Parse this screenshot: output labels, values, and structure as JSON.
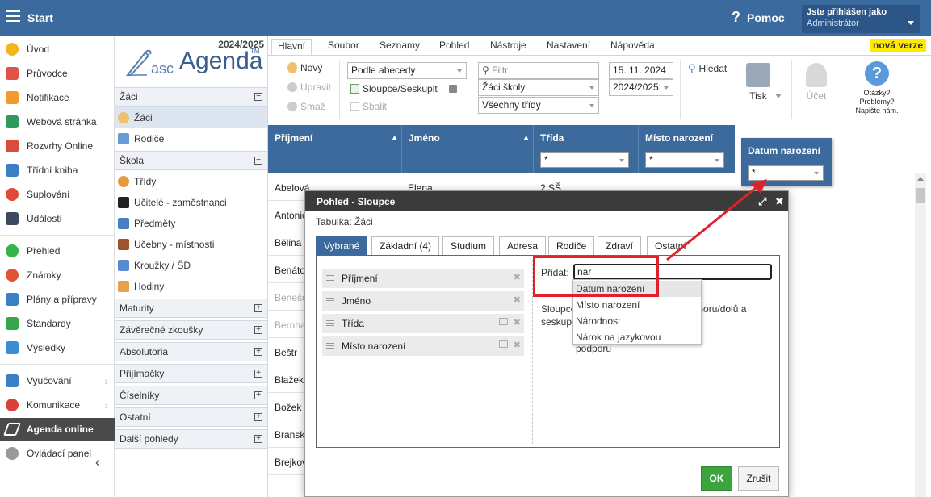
{
  "topbar": {
    "title": "Start",
    "help_label": "Pomoc",
    "user_line1": "Jste přihlášen jako",
    "user_line2": "Administrátor"
  },
  "colors": {
    "accent": "#3b6a9e",
    "ok": "#3da43d",
    "highlight": "#e0202a",
    "new_badge": "#ffeb00"
  },
  "sidebar": {
    "items": [
      {
        "label": "Úvod",
        "icon": "star-icon"
      },
      {
        "label": "Průvodce",
        "icon": "wand-icon"
      },
      {
        "label": "Notifikace",
        "icon": "envelope-icon"
      },
      {
        "label": "Webová stránka",
        "icon": "home-icon"
      },
      {
        "label": "Rozvrhy Online",
        "icon": "timetable-icon"
      },
      {
        "label": "Třídní kniha",
        "icon": "book-icon"
      },
      {
        "label": "Suplování",
        "icon": "person-icon"
      },
      {
        "label": "Události",
        "icon": "calendar-icon"
      },
      {
        "label": "Přehled",
        "icon": "check-circle-icon"
      },
      {
        "label": "Známky",
        "icon": "grade-icon"
      },
      {
        "label": "Plány a přípravy",
        "icon": "briefcase-icon"
      },
      {
        "label": "Standardy",
        "icon": "shield-icon"
      },
      {
        "label": "Výsledky",
        "icon": "bar-chart-icon"
      },
      {
        "label": "Vyučování",
        "icon": "monitor-icon"
      },
      {
        "label": "Komunikace",
        "icon": "chat-icon"
      },
      {
        "label": "Agenda online",
        "icon": "pen-icon"
      },
      {
        "label": "Ovládací panel",
        "icon": "gear-icon"
      }
    ]
  },
  "panel": {
    "year": "2024/2025",
    "logo_asc": "asc",
    "logo_agenda": "Agenda",
    "logo_tm": "TM",
    "sec_zaci": "Žáci",
    "item_zaci": "Žáci",
    "item_rodice": "Rodiče",
    "sec_skola": "Škola",
    "skola_items": [
      "Třídy",
      "Učitelé - zaměstnanci",
      "Předměty",
      "Učebny - místnosti",
      "Kroužky / ŠD",
      "Hodiny"
    ],
    "groups": [
      "Maturity",
      "Závěrečné zkoušky",
      "Absolutoria",
      "Přijímačky",
      "Číselníky",
      "Ostatní",
      "Další pohledy"
    ]
  },
  "menu": {
    "tabs": [
      "Hlavní",
      "Soubor",
      "Seznamy",
      "Pohled",
      "Nástroje",
      "Nastavení",
      "Nápověda"
    ],
    "new_version": "nová verze"
  },
  "toolbar": {
    "new": "Nový",
    "edit": "Upravit",
    "delete": "Smaž",
    "sort": "Podle abecedy",
    "columns": "Sloupce/Seskupit",
    "collapse": "Sbalit",
    "filter_placeholder": "Filtr",
    "filter_scope": "Žáci školy",
    "filter_class": "Všechny třídy",
    "date": "15. 11. 2024",
    "year": "2024/2025",
    "search": "Hledat",
    "print": "Tisk",
    "account": "Účet",
    "questions_1": "Otázky?",
    "questions_2": "Problémy?",
    "questions_3": "Napište nám."
  },
  "grid": {
    "columns": [
      {
        "label": "Příjmení",
        "filter": ""
      },
      {
        "label": "Jméno",
        "filter": ""
      },
      {
        "label": "Třída",
        "filter": "*"
      },
      {
        "label": "Místo narození",
        "filter": "*"
      }
    ],
    "dragged_column": {
      "label": "Datum narození",
      "filter": "*"
    },
    "rows": [
      {
        "surname": "Abelová",
        "faded": false
      },
      {
        "surname": "Antonio",
        "faded": false
      },
      {
        "surname": "Bělina",
        "faded": false
      },
      {
        "surname": "Benáto",
        "faded": false
      },
      {
        "surname": "Benešo",
        "faded": true
      },
      {
        "surname": "Bernha",
        "faded": true
      },
      {
        "surname": "Beštr",
        "faded": false
      },
      {
        "surname": "Blažek",
        "faded": false
      },
      {
        "surname": "Božek",
        "faded": false
      },
      {
        "surname": "Bransk",
        "faded": false
      },
      {
        "surname": "Brejkov",
        "faded": false
      }
    ],
    "first_row_name": "Elena",
    "first_row_class": "2.SŠ"
  },
  "dialog": {
    "title": "Pohled - Sloupce",
    "subtitle": "Tabulka: Žáci",
    "tabs": [
      "Vybrané",
      "Základní (4)",
      "Studium",
      "Adresa",
      "Rodiče",
      "Zdraví",
      "Ostatní"
    ],
    "selected_columns": [
      "Příjmení",
      "Jméno",
      "Třída",
      "Místo narození"
    ],
    "add_label": "Přidat:",
    "add_value": "nar",
    "hint_1": "Sloupce",
    "hint_2": "seskupi",
    "hint_3": "nahoru/dolů a",
    "suggestions": [
      "Datum narození",
      "Místo narození",
      "Národnost",
      "Nárok na jazykovou podporu"
    ],
    "ok": "OK",
    "cancel": "Zrušit"
  }
}
